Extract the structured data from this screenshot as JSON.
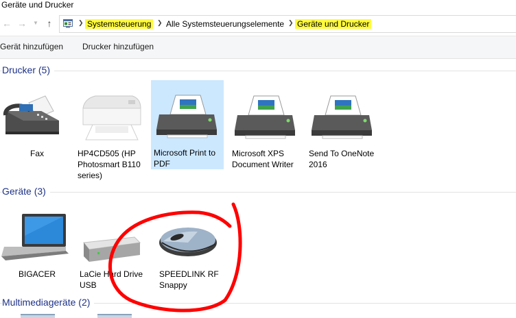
{
  "window": {
    "title": "Geräte und Drucker"
  },
  "nav": {
    "back_icon": "arrow-left-icon",
    "forward_icon": "arrow-right-icon",
    "recent_icon": "chevron-down-icon",
    "up_icon": "arrow-up-icon"
  },
  "breadcrumb": {
    "items": [
      "Systemsteuerung",
      "Alle Systemsteuerungselemente",
      "Geräte und Drucker"
    ],
    "highlight_color": "#fffb3a"
  },
  "toolbar": {
    "add_device": "Gerät hinzufügen",
    "add_printer": "Drucker hinzufügen"
  },
  "sections": {
    "printers": {
      "header": "Drucker (5)",
      "items": [
        {
          "label": "Fax",
          "icon": "fax-icon"
        },
        {
          "label": "HP4CD505 (HP Photosmart B110 series)",
          "icon": "inkjet-printer-icon"
        },
        {
          "label": "Microsoft Print to PDF",
          "icon": "printer-icon",
          "selected": true
        },
        {
          "label": "Microsoft XPS Document Writer",
          "icon": "printer-icon"
        },
        {
          "label": "Send To OneNote 2016",
          "icon": "printer-icon"
        }
      ]
    },
    "devices": {
      "header": "Geräte (3)",
      "items": [
        {
          "label": "BIGACER",
          "icon": "laptop-icon"
        },
        {
          "label": "LaCie Hard Drive USB",
          "icon": "hard-drive-icon"
        },
        {
          "label": "SPEEDLINK RF Snappy",
          "icon": "mouse-icon"
        }
      ]
    },
    "multimedia": {
      "header": "Multimediageräte (2)"
    }
  },
  "colors": {
    "section_header": "#1e3287",
    "selection": "#cce8ff",
    "annotation": "#ff0000"
  }
}
